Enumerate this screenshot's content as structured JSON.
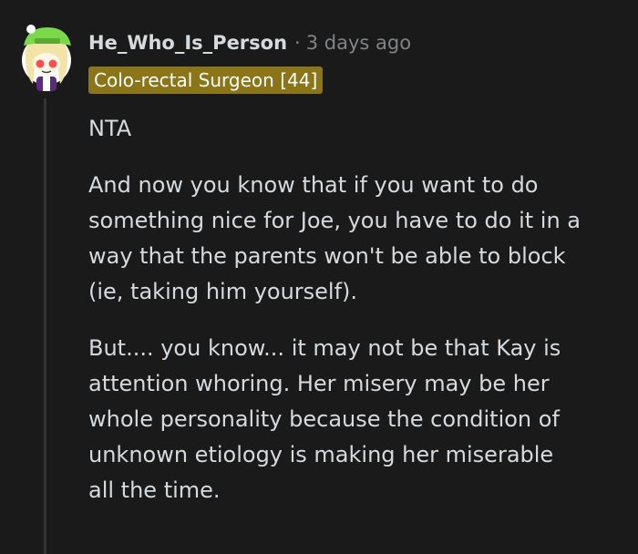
{
  "comment": {
    "author": "He_Who_Is_Person",
    "separator": "·",
    "timestamp": "3 days ago",
    "flair": {
      "text": "Colo-rectal Surgeon [44]",
      "background": "#8c7418"
    },
    "avatar": {
      "icon": "snoo-avatar-icon",
      "hat_color": "#7bd84a",
      "cheek_color": "#ff4d4d"
    },
    "paragraphs": [
      [
        "NTA"
      ],
      [
        "And now you know that if you want to do",
        "something nice for Joe, you have to do it in a",
        "way that the parents won't be able to block",
        "(ie, taking him yourself)."
      ],
      [
        "But.... you know... it may not be that Kay is",
        "attention whoring. Her misery may be her",
        "whole personality because the condition of",
        "unknown etiology is making her miserable",
        "all the time."
      ]
    ]
  },
  "theme": {
    "background": "#1a1a1b",
    "text": "#d7dadc",
    "muted": "#818384",
    "thread_line": "#343536"
  }
}
